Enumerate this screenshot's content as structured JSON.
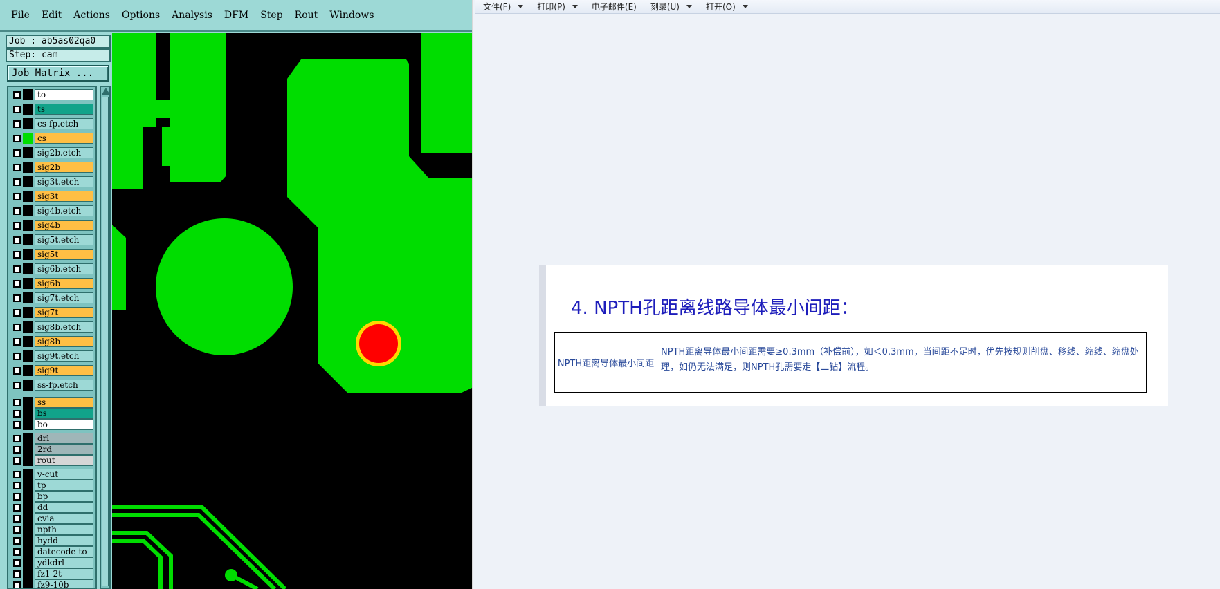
{
  "cam": {
    "menu": [
      {
        "label": "File",
        "u": "F",
        "rest": "ile"
      },
      {
        "label": "Edit",
        "u": "E",
        "rest": "dit"
      },
      {
        "label": "Actions",
        "u": "A",
        "rest": "ctions"
      },
      {
        "label": "Options",
        "u": "O",
        "rest": "ptions"
      },
      {
        "label": "Analysis",
        "u": "A",
        "rest": "nalysis"
      },
      {
        "label": "DFM",
        "u": "D",
        "rest": "FM"
      },
      {
        "label": "Step",
        "u": "S",
        "rest": "tep"
      },
      {
        "label": "Rout",
        "u": "R",
        "rest": "out"
      },
      {
        "label": "Windows",
        "u": "W",
        "rest": "indows"
      }
    ],
    "job_line": "Job : ab5as02qa0",
    "step_line": "Step: cam",
    "matrix_button": "Job Matrix ...",
    "layers": [
      {
        "name": "to",
        "color": "white",
        "active": false
      },
      {
        "name": "ts",
        "color": "teal",
        "active": false
      },
      {
        "name": "cs-fp.etch",
        "color": "cyan",
        "active": false
      },
      {
        "name": "cs",
        "color": "orange",
        "active": true
      },
      {
        "name": "sig2b.etch",
        "color": "cyan",
        "active": false
      },
      {
        "name": "sig2b",
        "color": "orange",
        "active": false
      },
      {
        "name": "sig3t.etch",
        "color": "cyan",
        "active": false
      },
      {
        "name": "sig3t",
        "color": "orange",
        "active": false
      },
      {
        "name": "sig4b.etch",
        "color": "cyan",
        "active": false
      },
      {
        "name": "sig4b",
        "color": "orange",
        "active": false
      },
      {
        "name": "sig5t.etch",
        "color": "cyan",
        "active": false
      },
      {
        "name": "sig5t",
        "color": "orange",
        "active": false
      },
      {
        "name": "sig6b.etch",
        "color": "cyan",
        "active": false
      },
      {
        "name": "sig6b",
        "color": "orange",
        "active": false
      },
      {
        "name": "sig7t.etch",
        "color": "cyan",
        "active": false
      },
      {
        "name": "sig7t",
        "color": "orange",
        "active": false
      },
      {
        "name": "sig8b.etch",
        "color": "cyan",
        "active": false
      },
      {
        "name": "sig8b",
        "color": "orange",
        "active": false
      },
      {
        "name": "sig9t.etch",
        "color": "cyan",
        "active": false
      },
      {
        "name": "sig9t",
        "color": "orange",
        "active": false
      },
      {
        "name": "ss-fp.etch",
        "color": "cyan",
        "active": false
      },
      {
        "name": "ss",
        "color": "orange",
        "active": false
      },
      {
        "name": "bs",
        "color": "teal",
        "active": false
      },
      {
        "name": "bo",
        "color": "white",
        "active": false
      },
      {
        "name": "drl",
        "color": "grey",
        "active": false
      },
      {
        "name": "2rd",
        "color": "grey",
        "active": false
      },
      {
        "name": "rout",
        "color": "lightgrey",
        "active": false
      },
      {
        "name": "v-cut",
        "color": "cyan",
        "active": false
      },
      {
        "name": "tp",
        "color": "cyan",
        "active": false
      },
      {
        "name": "bp",
        "color": "cyan",
        "active": false
      },
      {
        "name": "dd",
        "color": "cyan",
        "active": false
      },
      {
        "name": "cvia",
        "color": "cyan",
        "active": false
      },
      {
        "name": "npth",
        "color": "cyan",
        "active": false
      },
      {
        "name": "hydd",
        "color": "cyan",
        "active": false
      },
      {
        "name": "datecode-to",
        "color": "cyan",
        "active": false
      },
      {
        "name": "ydkdrl",
        "color": "cyan",
        "active": false
      },
      {
        "name": "fz1-2t",
        "color": "cyan",
        "active": false
      },
      {
        "name": "fz9-10b",
        "color": "cyan",
        "active": false
      }
    ],
    "colors": {
      "copper": "#00dd00",
      "pad_fill": "#ff0000",
      "pad_ring": "#ffd700",
      "background": "#000000"
    }
  },
  "viewer": {
    "toolbar": [
      {
        "label": "文件(F)",
        "dropdown": true
      },
      {
        "label": "打印(P)",
        "dropdown": true
      },
      {
        "label": "电子邮件(E)",
        "dropdown": false
      },
      {
        "label": "刻录(U)",
        "dropdown": true
      },
      {
        "label": "打开(O)",
        "dropdown": true
      }
    ],
    "heading": "4. NPTH孔距离线路导体最小间距：",
    "table": {
      "item": "NPTH距离导体最小间距",
      "requirement": "NPTH距离导体最小间距需要≥0.3mm（补偿前），如＜0.3mm，当间距不足时，优先按规则削盘、移线、缩线、缩盘处理，如仍无法满足，则NPTH孔需要走【二钻】流程。"
    }
  }
}
